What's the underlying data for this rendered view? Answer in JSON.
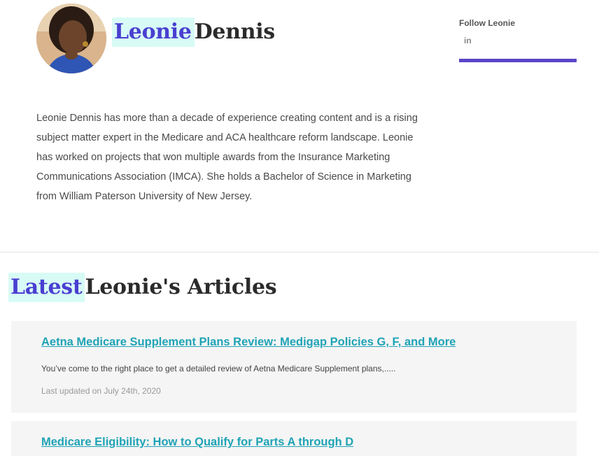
{
  "profile": {
    "first_name": "Leonie",
    "last_name": "Dennis",
    "bio": "Leonie Dennis has more than a decade of experience creating content and is a rising subject matter expert in the Medicare and ACA healthcare reform landscape. Leonie has worked on projects that won multiple awards from the Insurance Marketing Communications Association (IMCA). She holds a Bachelor of Science in Marketing from William Paterson University of New Jersey."
  },
  "follow": {
    "title": "Follow Leonie",
    "linkedin_label": "in"
  },
  "articles_section": {
    "highlight": "Latest",
    "rest": "Leonie's Articles"
  },
  "articles": [
    {
      "title": "Aetna Medicare Supplement Plans Review: Medigap Policies G, F, and More",
      "excerpt": "You’ve come to the right place to get a detailed review of Aetna Medicare Supplement plans,.....",
      "date": "Last updated on July 24th, 2020"
    },
    {
      "title": "Medicare Eligibility: How to Qualify for Parts A through D"
    }
  ],
  "colors": {
    "accent": "#4a3fd1",
    "highlight_bg": "#d8fbf6",
    "link": "#1fa3b5",
    "follow_bar": "#5a45c8",
    "card_bg": "#f5f5f5"
  }
}
